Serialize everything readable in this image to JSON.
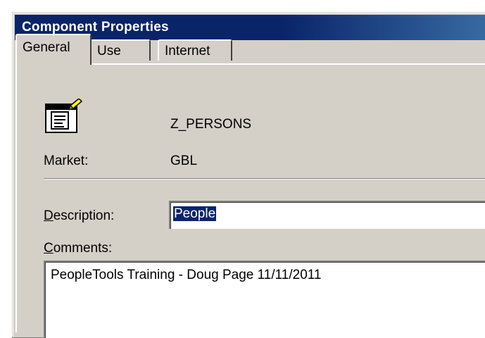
{
  "window": {
    "title": "Component Properties"
  },
  "tabs": [
    {
      "label": "General",
      "active": true
    },
    {
      "label": "Use",
      "active": false
    },
    {
      "label": "Internet",
      "active": false
    }
  ],
  "general": {
    "component_icon": "component-page-icon",
    "component_name": "Z_PERSONS",
    "market_label": "Market:",
    "market_value": "GBL",
    "description_label": "Description:",
    "description_mnemonic": "D",
    "description_rest": "escription:",
    "description_value": "People",
    "comments_label": "Comments:",
    "comments_mnemonic": "C",
    "comments_rest": "omments:",
    "comments_value": "PeopleTools Training - Doug Page 11/11/2011"
  },
  "colors": {
    "titlebar": "#0a246a",
    "dialog_face": "#d4d0c8",
    "selection": "#0a246a"
  }
}
